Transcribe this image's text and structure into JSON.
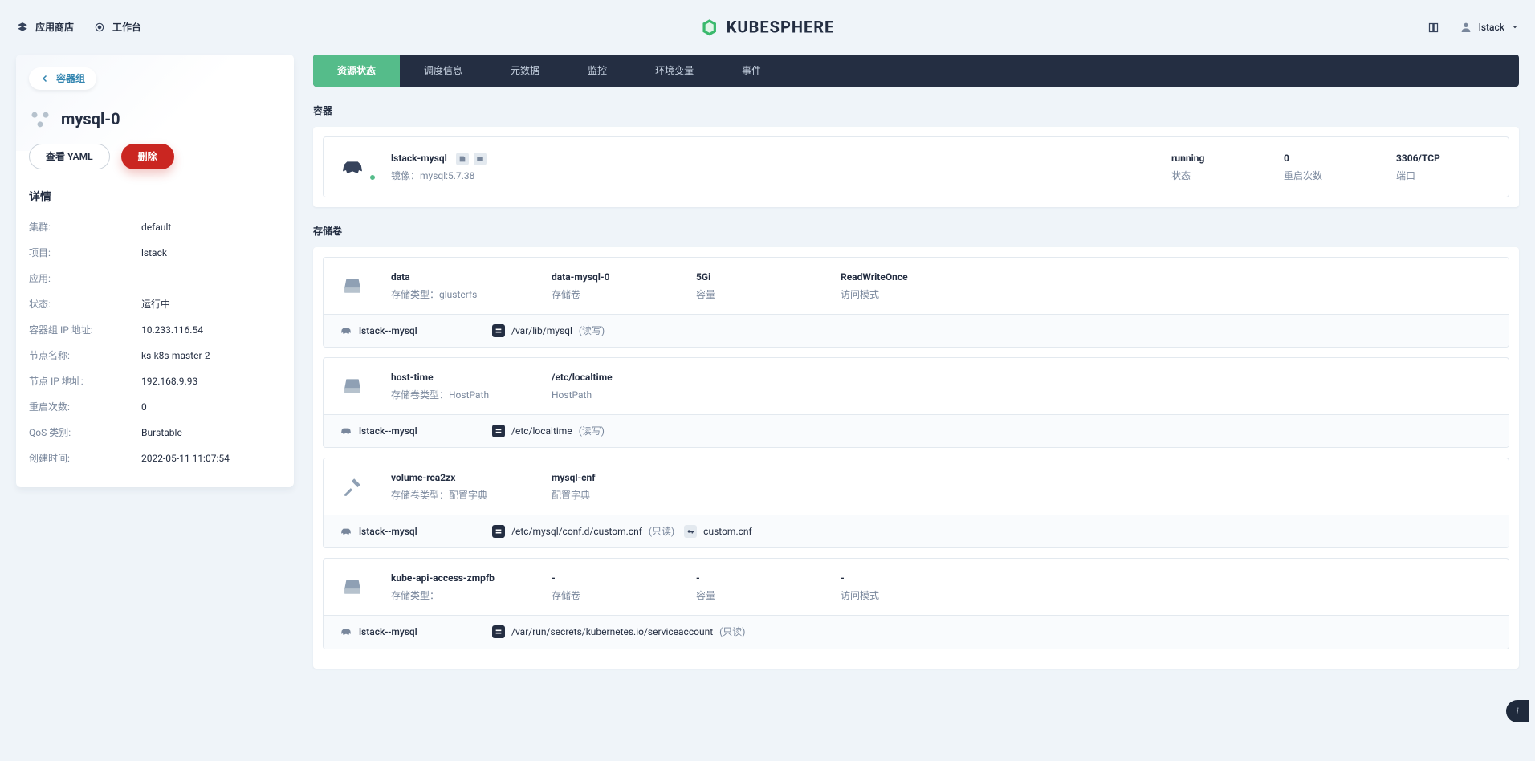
{
  "topbar": {
    "app_store": "应用商店",
    "workbench": "工作台",
    "brand": "KUBESPHERE",
    "user": "lstack"
  },
  "sidebar": {
    "crumb": "容器组",
    "title": "mysql-0",
    "view_yaml": "查看 YAML",
    "delete": "删除",
    "detail_header": "详情",
    "items": [
      {
        "k": "集群:",
        "v": "default"
      },
      {
        "k": "项目:",
        "v": "lstack"
      },
      {
        "k": "应用:",
        "v": "-"
      },
      {
        "k": "状态:",
        "v": "运行中"
      },
      {
        "k": "容器组 IP 地址:",
        "v": "10.233.116.54"
      },
      {
        "k": "节点名称:",
        "v": "ks-k8s-master-2"
      },
      {
        "k": "节点 IP 地址:",
        "v": "192.168.9.93"
      },
      {
        "k": "重启次数:",
        "v": "0"
      },
      {
        "k": "QoS 类别:",
        "v": "Burstable"
      },
      {
        "k": "创建时间:",
        "v": "2022-05-11 11:07:54"
      }
    ]
  },
  "tabs": [
    "资源状态",
    "调度信息",
    "元数据",
    "监控",
    "环境变量",
    "事件"
  ],
  "section_container": "容器",
  "section_volume": "存储卷",
  "container": {
    "name": "lstack-mysql",
    "image_label": "镜像：",
    "image": "mysql:5.7.38",
    "status": "running",
    "status_label": "状态",
    "restarts": "0",
    "restarts_label": "重启次数",
    "ports": "3306/TCP",
    "ports_label": "端口"
  },
  "volumes": [
    {
      "icon": "disk",
      "a_t": "data",
      "a_s": "存储类型：glusterfs",
      "b_t": "data-mysql-0",
      "b_s": "存储卷",
      "c_t": "5Gi",
      "c_s": "容量",
      "d_t": "ReadWriteOnce",
      "d_s": "访问模式",
      "mount_name": "lstack--mysql",
      "mount_path": "/var/lib/mysql",
      "mount_mode": "(读写)",
      "extra_chip": false,
      "extra_text": ""
    },
    {
      "icon": "disk",
      "a_t": "host-time",
      "a_s": "存储卷类型：HostPath",
      "b_t": "/etc/localtime",
      "b_s": "HostPath",
      "c_t": "",
      "c_s": "",
      "d_t": "",
      "d_s": "",
      "mount_name": "lstack--mysql",
      "mount_path": "/etc/localtime",
      "mount_mode": "(读写)",
      "extra_chip": false,
      "extra_text": ""
    },
    {
      "icon": "hammer",
      "a_t": "volume-rca2zx",
      "a_s": "存储卷类型：配置字典",
      "b_t": "mysql-cnf",
      "b_s": "配置字典",
      "c_t": "",
      "c_s": "",
      "d_t": "",
      "d_s": "",
      "mount_name": "lstack--mysql",
      "mount_path": "/etc/mysql/conf.d/custom.cnf",
      "mount_mode": "(只读)",
      "extra_chip": true,
      "extra_text": "custom.cnf"
    },
    {
      "icon": "disk",
      "a_t": "kube-api-access-zmpfb",
      "a_s": "存储类型：-",
      "b_t": "-",
      "b_s": "存储卷",
      "c_t": "-",
      "c_s": "容量",
      "d_t": "-",
      "d_s": "访问模式",
      "mount_name": "lstack--mysql",
      "mount_path": "/var/run/secrets/kubernetes.io/serviceaccount",
      "mount_mode": "(只读)",
      "extra_chip": false,
      "extra_text": ""
    }
  ]
}
